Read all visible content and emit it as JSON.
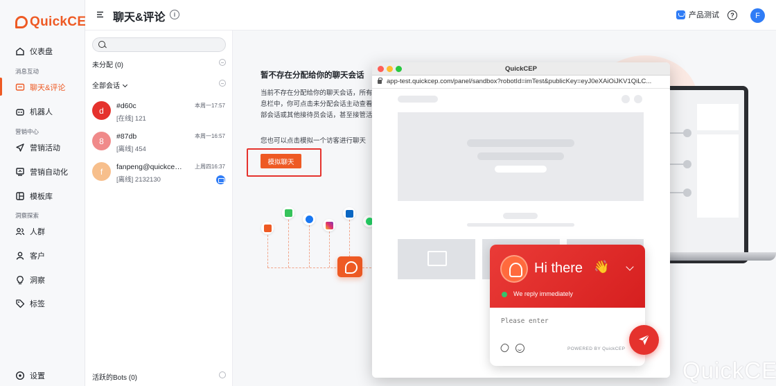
{
  "app": {
    "logo_text": "QuickCEP"
  },
  "sidebar": {
    "items": [
      {
        "label": "仪表盘",
        "icon": "home-icon"
      },
      {
        "group": "消息互动"
      },
      {
        "label": "聊天&评论",
        "icon": "chat-icon",
        "active": true
      },
      {
        "label": "机器人",
        "icon": "robot-icon"
      },
      {
        "group": "营销中心"
      },
      {
        "label": "营销活动",
        "icon": "send-icon"
      },
      {
        "label": "营销自动化",
        "icon": "automation-icon"
      },
      {
        "label": "模板库",
        "icon": "template-icon"
      },
      {
        "group": "洞察探索"
      },
      {
        "label": "人群",
        "icon": "people-icon"
      },
      {
        "label": "客户",
        "icon": "user-icon"
      },
      {
        "label": "洞察",
        "icon": "bulb-icon"
      },
      {
        "label": "标签",
        "icon": "tag-icon"
      }
    ],
    "settings_label": "设置",
    "accent_color": "#ee5a24"
  },
  "header": {
    "title": "聊天&评论",
    "workspace_label": "产品测试",
    "help_label": "?",
    "avatar_letter": "F"
  },
  "conversations": {
    "search_placeholder": "",
    "unassigned_label": "未分配 (0)",
    "all_label": "全部会话",
    "items": [
      {
        "avatar": "d",
        "avatar_color": "#e5322d",
        "name": "#d60c",
        "time": "本周一17:57",
        "status": "[在线] 121"
      },
      {
        "avatar": "8",
        "avatar_color": "#f08a8a",
        "name": "#87db",
        "time": "本周一16:57",
        "status": "[离线] 454"
      },
      {
        "avatar": "f",
        "avatar_color": "#f7bf8c",
        "name": "fanpeng@quickcep.c...",
        "time": "上周四16:37",
        "status": "[离线] 2132130",
        "channel": "email-icon"
      }
    ],
    "bots_label": "活跃的Bots (0)"
  },
  "main": {
    "empty_title": "暂不存在分配给你的聊天会话",
    "empty_desc_lines": [
      "当前不存在分配给你的聊天会话，所有会",
      "息栏中，你可点击未分配会话主动查看会",
      "部会话或其他接待员会话，甚至接管活跃"
    ],
    "empty_hint": "您也可以点击模拟一个访客进行聊天",
    "simulate_button": "模拟聊天",
    "channel_icons": [
      "email-icon",
      "line-icon",
      "facebook-icon",
      "instagram-icon",
      "linkedin-icon",
      "whatsapp-icon"
    ]
  },
  "popup": {
    "title": "QuickCEP",
    "url": "app-test.quickcep.com/panel/sandbox?robotId=imTest&publicKey=eyJ0eXAiOiJKV1QiLC..."
  },
  "widget": {
    "greeting": "Hi there",
    "wave": "👋",
    "reply_status": "We reply immediately",
    "input_placeholder": "Please enter",
    "powered_by": "POWERED BY QuickCEP",
    "header_color": "#e5322d"
  },
  "watermark": "QuickCEP"
}
